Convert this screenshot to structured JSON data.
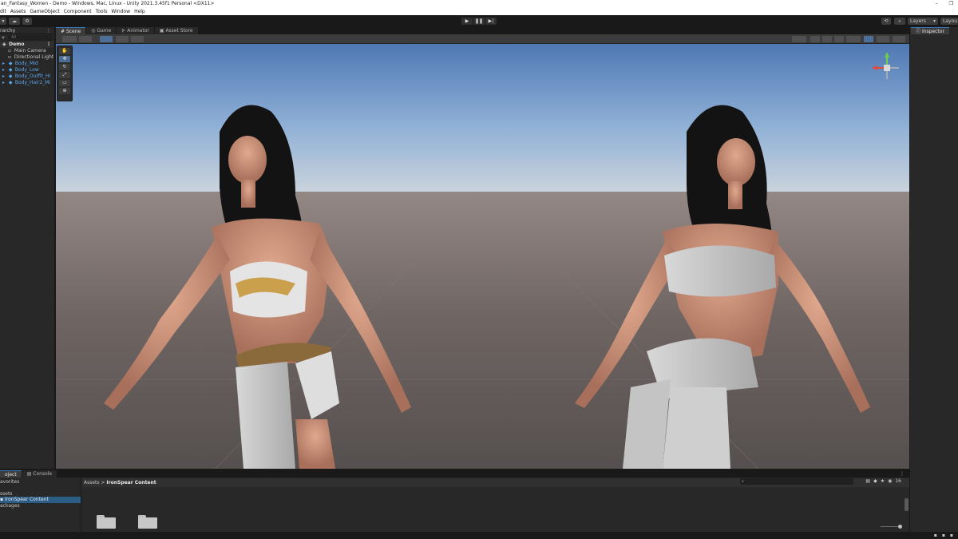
{
  "window": {
    "title": "an_Fantasy_Women - Demo - Windows, Mac, Linux - Unity 2021.3.45f1 Personal <DX11>"
  },
  "menu": [
    "dit",
    "Assets",
    "GameObject",
    "Component",
    "Tools",
    "Window",
    "Help"
  ],
  "toolbar": {
    "layers_label": "Layers",
    "layout_label": "Layou"
  },
  "hierarchy": {
    "tab_label": "rarchy",
    "search_placeholder": "All",
    "scene_name": "Demo",
    "items": [
      {
        "label": "Main Camera"
      },
      {
        "label": "Directional Light"
      },
      {
        "label": "Body_Mid"
      },
      {
        "label": "Body_Low"
      },
      {
        "label": "Body_Outfit_Hi"
      },
      {
        "label": "Body_Hair2_Mi"
      }
    ]
  },
  "scene": {
    "tabs": [
      "Scene",
      "Game",
      "Animator",
      "Asset Store"
    ],
    "active_tab": "Scene"
  },
  "project": {
    "tabs": [
      "oject",
      "Console"
    ],
    "favorites_label": "avorites",
    "tree": [
      {
        "label": "ssets"
      },
      {
        "label": "IronSpear Content"
      },
      {
        "label": "ackages"
      }
    ],
    "breadcrumb_root": "Assets",
    "breadcrumb_sep": ">",
    "breadcrumb_current": "IronSpear Content",
    "hidden_count": "16"
  },
  "inspector": {
    "tab_label": "Inspector"
  },
  "colors": {
    "accent": "#3a79bb",
    "panel": "#282828",
    "prefab_text": "#5ca8ef",
    "selection": "#2c5d87"
  }
}
